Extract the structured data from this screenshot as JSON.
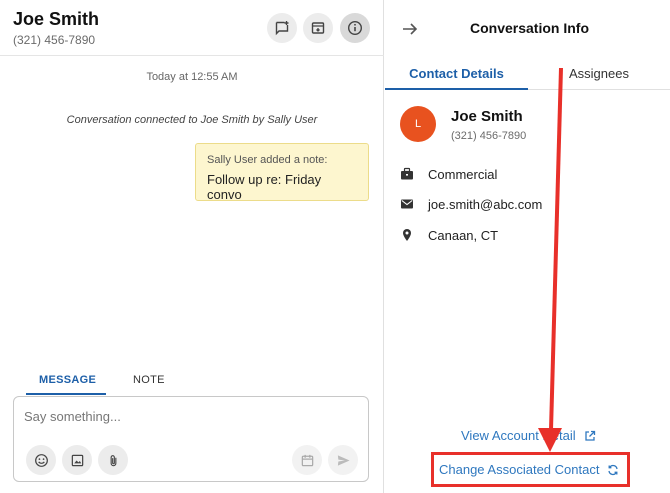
{
  "conversation": {
    "contact_name": "Joe Smith",
    "contact_phone": "(321) 456-7890",
    "timestamp": "Today at 12:55 AM",
    "system_message": "Conversation connected to Joe Smith by Sally User",
    "note": {
      "meta": "Sally User added a note:",
      "text": "Follow up re: Friday convo"
    }
  },
  "composer": {
    "tabs": [
      "MESSAGE",
      "NOTE"
    ],
    "active_tab": "MESSAGE",
    "placeholder": "Say something..."
  },
  "info_panel": {
    "title": "Conversation Info",
    "tabs": [
      "Contact Details",
      "Assignees"
    ],
    "active_tab": "Contact Details",
    "avatar_initial": "L",
    "contact_name": "Joe Smith",
    "contact_phone": "(321) 456-7890",
    "details": [
      {
        "icon": "briefcase-icon",
        "value": "Commercial"
      },
      {
        "icon": "email-icon",
        "value": "joe.smith@abc.com"
      },
      {
        "icon": "location-pin-icon",
        "value": "Canaan, CT"
      }
    ],
    "view_account_label": "View Account Detail",
    "change_contact_label": "Change Associated Contact"
  },
  "colors": {
    "accent": "#1d5fa8",
    "link": "#2f78bf",
    "avatar": "#e8521f",
    "note_bg": "#fdf6cf",
    "annotation": "#e8302a"
  }
}
